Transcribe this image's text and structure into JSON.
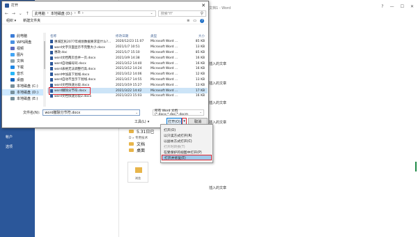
{
  "word": {
    "title": "文档1 - Word",
    "nav": [
      "帐户",
      "选项"
    ],
    "window_controls": [
      "?",
      "—",
      "☐",
      "✕"
    ],
    "bg_items": [
      "插入的文章",
      "插入的文章",
      "插入的文章",
      "插入的文章",
      "插入的文章"
    ],
    "recent": [
      {
        "label": "5.31日已"
      },
      {
        "label": "D » 专用技术"
      },
      {
        "label": "文档"
      },
      {
        "label": "桌面"
      }
    ],
    "browse_label": "浏览"
  },
  "dialog": {
    "title": "打开",
    "close": "✕",
    "nav_back": "←",
    "nav_forward": "→",
    "nav_down": "⌄",
    "nav_up": "↑",
    "path": [
      "此电脑",
      "本地磁盘 (D:)",
      "fl"
    ],
    "search_placeholder": "搜索\"fl\"",
    "toolbar": {
      "organize": "组织 ▾",
      "new_folder": "新建文件夹",
      "view_icon": "≡",
      "help": "?"
    },
    "sidebar": [
      {
        "label": "此电脑",
        "color": "#3b7dd8",
        "selected": false
      },
      {
        "label": "WPS网盘",
        "color": "#4a90e2",
        "selected": false
      },
      {
        "label": "视频",
        "color": "#5c6bc0",
        "selected": false
      },
      {
        "label": "图片",
        "color": "#42a5f5",
        "selected": false
      },
      {
        "label": "文档",
        "color": "#90a4ae",
        "selected": false
      },
      {
        "label": "下载",
        "color": "#1e88e5",
        "selected": false
      },
      {
        "label": "音乐",
        "color": "#29b6f6",
        "selected": false
      },
      {
        "label": "桌面",
        "color": "#1565c0",
        "selected": false
      },
      {
        "label": "本地磁盘 (C:)",
        "color": "#78909c",
        "selected": false
      },
      {
        "label": "本地磁盘 (D:)",
        "color": "#78909c",
        "selected": true
      },
      {
        "label": "本地磁盘 (E:)",
        "color": "#78909c",
        "selected": false
      }
    ],
    "columns": {
      "name": "名称",
      "date": "修改日期",
      "type": "类型",
      "size": "大小"
    },
    "files": [
      {
        "name": "惠城区民2077年规划数据要求是什么?…",
        "date": "2020/12/23 11:07",
        "type": "Microsoft Word ...",
        "size": "85 KB",
        "selected": false
      },
      {
        "name": "word文字页面显示不完整大小.docx",
        "date": "2021/1/7 10:51",
        "type": "Microsoft Word ...",
        "size": "13 KB",
        "selected": false
      },
      {
        "name": "惠政.doc",
        "date": "2021/1/7 15:10",
        "type": "Microsoft Word ...",
        "size": "85 KB",
        "selected": false
      },
      {
        "name": "word文档两页合并一页.docx",
        "date": "2021/3/9 14:38",
        "type": "Microsoft Word ...",
        "size": "16 KB",
        "selected": false
      },
      {
        "name": "word自动编号同.docx",
        "date": "2021/3/12 14:40",
        "type": "Microsoft Word ...",
        "size": "16 KB",
        "selected": false
      },
      {
        "name": "word表格无法调整行高.docx",
        "date": "2021/3/12 14:24",
        "type": "Microsoft Word ...",
        "size": "16 KB",
        "selected": false
      },
      {
        "name": "word中加盖下划线.docx",
        "date": "2021/3/12 14:06",
        "type": "Microsoft Word ...",
        "size": "12 KB",
        "selected": false
      },
      {
        "name": "word自动不显示下划线.docx",
        "date": "2021/3/17 14:55",
        "type": "Microsoft Word ...",
        "size": "13 KB",
        "selected": false
      },
      {
        "name": "word文档快速分段.docx",
        "date": "2021/3/19 15:27",
        "type": "Microsoft Word ...",
        "size": "13 KB",
        "selected": false
      },
      {
        "name": "word撤除分节符.docx",
        "date": "2021/3/22 14:42",
        "type": "Microsoft Word ...",
        "size": "17 KB",
        "selected": true
      },
      {
        "name": "word文档快速分段2.docx",
        "date": "2021/3/23 15:03",
        "type": "Microsoft Word ...",
        "size": "16 KB",
        "selected": false
      }
    ],
    "filename_label": "文件名(N):",
    "filename_value": "word撤除分节符.docx",
    "filetype_value": "所有 Word 文档(*.docx;*.doc;*.docm",
    "tools_label": "工具(L)",
    "open_label": "打开(O)",
    "open_split": "▾",
    "cancel_label": "取消",
    "open_menu": [
      {
        "label": "打开(O)",
        "disabled": false,
        "highlight": false
      },
      {
        "label": "以只读方式打开(R)",
        "disabled": false,
        "highlight": false
      },
      {
        "label": "以副本方式打开(C)",
        "disabled": false,
        "highlight": false
      },
      {
        "label": "打开时转换(T)",
        "disabled": true,
        "highlight": false
      },
      {
        "label": "在受保护的视图中打开(P)",
        "disabled": false,
        "highlight": false
      },
      {
        "label": "打开并修复(E)",
        "disabled": false,
        "highlight": true
      }
    ]
  }
}
